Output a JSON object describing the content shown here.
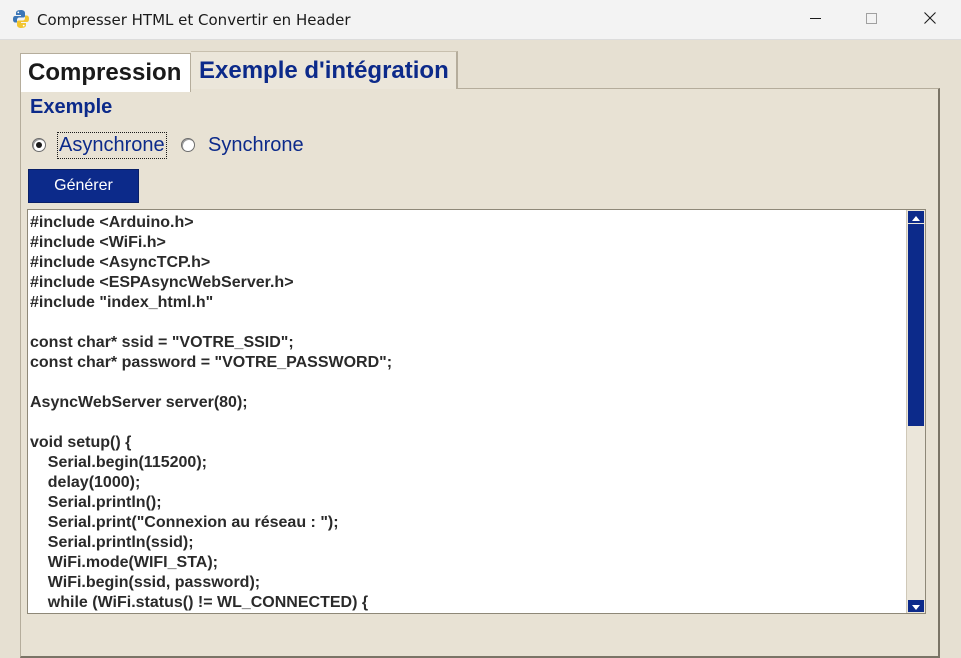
{
  "window": {
    "title": "Compresser HTML et Convertir en Header",
    "app_icon": "python-icon",
    "controls": [
      "minimize-icon",
      "maximize-icon",
      "close-icon"
    ]
  },
  "tabs": [
    {
      "label": "Compression",
      "active": true
    },
    {
      "label": "Exemple d'intégration",
      "active": false
    }
  ],
  "section": {
    "title": "Exemple"
  },
  "mode": {
    "options": [
      {
        "label": "Asynchrone",
        "checked": true
      },
      {
        "label": "Synchrone",
        "checked": false
      }
    ]
  },
  "generate_label": "Générer",
  "code_lines": [
    "#include <Arduino.h>",
    "#include <WiFi.h>",
    "#include <AsyncTCP.h>",
    "#include <ESPAsyncWebServer.h>",
    "#include \"index_html.h\"",
    "",
    "const char* ssid = \"VOTRE_SSID\";",
    "const char* password = \"VOTRE_PASSWORD\";",
    "",
    "AsyncWebServer server(80);",
    "",
    "void setup() {",
    "    Serial.begin(115200);",
    "    delay(1000);",
    "    Serial.println();",
    "    Serial.print(\"Connexion au réseau : \");",
    "    Serial.println(ssid);",
    "    WiFi.mode(WIFI_STA);",
    "    WiFi.begin(ssid, password);",
    "    while (WiFi.status() != WL_CONNECTED) {"
  ],
  "colors": {
    "accent": "#0c2a8a",
    "panel_bg": "#e6e0d2",
    "code_text": "#2a2a2a"
  }
}
